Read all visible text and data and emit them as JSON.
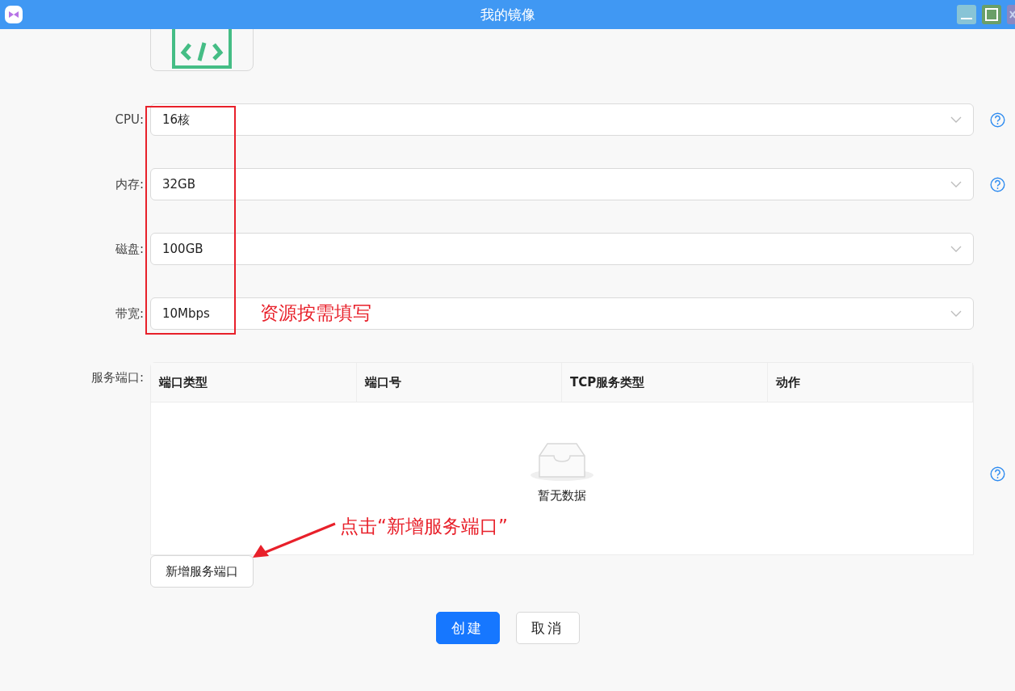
{
  "window": {
    "title": "我的镜像"
  },
  "form": {
    "fields": [
      {
        "label": "CPU:",
        "value": "16核",
        "help": true
      },
      {
        "label": "内存:",
        "value": "32GB",
        "help": true
      },
      {
        "label": "磁盘:",
        "value": "100GB",
        "help": false
      },
      {
        "label": "带宽:",
        "value": "10Mbps",
        "help": false
      }
    ]
  },
  "ports": {
    "label": "服务端口:",
    "columns": [
      "端口类型",
      "端口号",
      "TCP服务类型",
      "动作"
    ],
    "empty_text": "暂无数据",
    "help": true,
    "add_button": "新增服务端口"
  },
  "buttons": [
    {
      "label": "创建",
      "kind": "primary"
    },
    {
      "label": "取消",
      "kind": "default"
    }
  ],
  "annotations": {
    "resource_note": "资源按需填写",
    "click_note": "点击“新增服务端口”"
  }
}
